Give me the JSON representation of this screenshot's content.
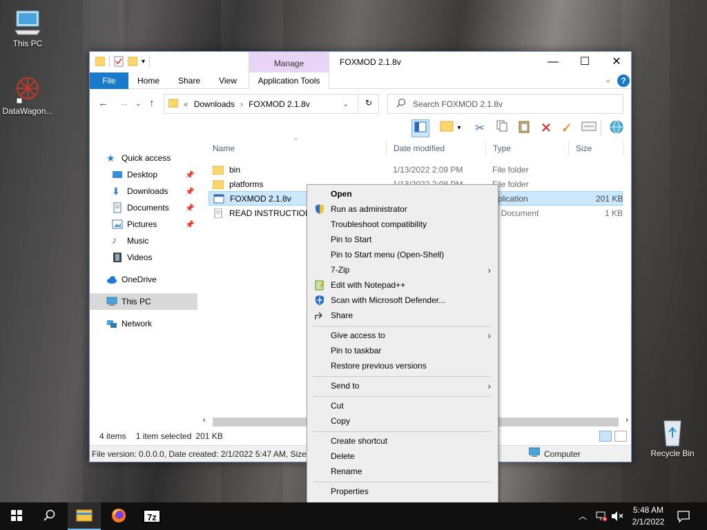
{
  "desktop": {
    "icons": [
      {
        "label": "This PC"
      },
      {
        "label": "DataWagon..."
      },
      {
        "label": "Recycle Bin"
      }
    ]
  },
  "window": {
    "title": "FOXMOD 2.1.8v",
    "manage_label": "Manage",
    "ribbon_tabs": [
      "File",
      "Home",
      "Share",
      "View",
      "Application Tools"
    ],
    "controls": {
      "minimize": "—",
      "maximize": "☐",
      "close": "✕"
    },
    "address": {
      "prefix": "«",
      "crumbs": [
        "Downloads",
        "FOXMOD 2.1.8v"
      ]
    },
    "search_placeholder": "Search FOXMOD 2.1.8v",
    "nav": [
      {
        "label": "Quick access"
      },
      {
        "label": "Desktop",
        "pinned": true
      },
      {
        "label": "Downloads",
        "pinned": true
      },
      {
        "label": "Documents",
        "pinned": true
      },
      {
        "label": "Pictures",
        "pinned": true
      },
      {
        "label": "Music"
      },
      {
        "label": "Videos"
      },
      {
        "label": "OneDrive"
      },
      {
        "label": "This PC",
        "selected": true
      },
      {
        "label": "Network"
      }
    ],
    "columns": [
      "Name",
      "Date modified",
      "Type",
      "Size"
    ],
    "files": [
      {
        "name": "bin",
        "date": "1/13/2022 2:09 PM",
        "type": "File folder",
        "size": ""
      },
      {
        "name": "platforms",
        "date": "1/13/2022 2:08 PM",
        "type": "File folder",
        "size": ""
      },
      {
        "name": "FOXMOD 2.1.8v",
        "date": "",
        "type": "pplication",
        "size": "201 KB",
        "selected": true
      },
      {
        "name": "READ INSTRUCTIONS",
        "date": "",
        "type": "xt Document",
        "size": "1 KB"
      }
    ],
    "status": {
      "count": "4 items",
      "selected": "1 item selected",
      "size": "201 KB"
    },
    "infobar": {
      "text": "File version: 0.0.0.0, Date created: 2/1/2022 5:47 AM, Size: 20",
      "computer": "Computer"
    }
  },
  "context_menu": {
    "items": [
      {
        "label": "Open",
        "bold": true
      },
      {
        "label": "Run as administrator",
        "icon": "shield-icon"
      },
      {
        "label": "Troubleshoot compatibility"
      },
      {
        "label": "Pin to Start"
      },
      {
        "label": "Pin to Start menu (Open-Shell)"
      },
      {
        "label": "7-Zip",
        "submenu": true
      },
      {
        "label": "Edit with Notepad++",
        "icon": "notepad-icon"
      },
      {
        "label": "Scan with Microsoft Defender...",
        "icon": "defender-icon"
      },
      {
        "label": "Share",
        "icon": "share-icon"
      },
      {
        "label": "Give access to",
        "submenu": true
      },
      {
        "label": "Pin to taskbar"
      },
      {
        "label": "Restore previous versions"
      },
      {
        "label": "Send to",
        "submenu": true
      },
      {
        "label": "Cut"
      },
      {
        "label": "Copy"
      },
      {
        "label": "Create shortcut"
      },
      {
        "label": "Delete"
      },
      {
        "label": "Rename"
      },
      {
        "label": "Properties"
      }
    ]
  },
  "taskbar": {
    "time": "5:48 AM",
    "date": "2/1/2022",
    "sevenzip_label": "7z"
  }
}
